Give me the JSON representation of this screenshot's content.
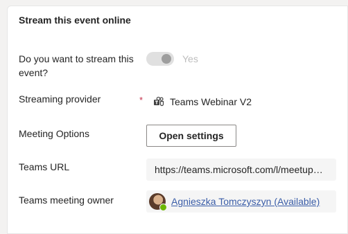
{
  "section": {
    "title": "Stream this event online"
  },
  "stream": {
    "label": "Do you want to stream this event?",
    "toggle_text": "Yes",
    "toggle_on": true
  },
  "provider": {
    "label": "Streaming provider",
    "required_marker": "*",
    "value": "Teams Webinar V2",
    "icon": "teams-icon"
  },
  "meeting_options": {
    "label": "Meeting Options",
    "button": "Open settings"
  },
  "teams_url": {
    "label": "Teams URL",
    "value": "https://teams.microsoft.com/l/meetup…"
  },
  "owner": {
    "label": "Teams meeting owner",
    "value": "Agnieszka Tomczyszyn (Available)",
    "presence_color": "#6bb700"
  }
}
